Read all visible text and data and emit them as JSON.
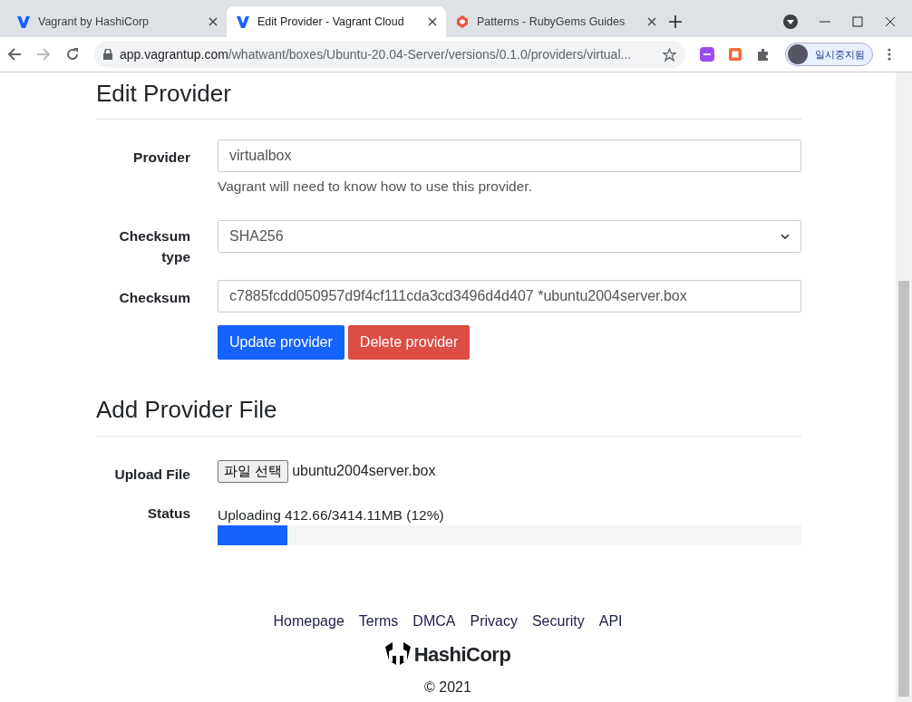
{
  "browser": {
    "tabs": [
      {
        "title": "Vagrant by HashiCorp",
        "selected": false,
        "kind": "vagrant"
      },
      {
        "title": "Edit Provider - Vagrant Cloud",
        "selected": true,
        "kind": "vagrant"
      },
      {
        "title": "Patterns - RubyGems Guides",
        "selected": false,
        "kind": "rubygems"
      }
    ],
    "url_host": "app.vagrantup.com",
    "url_path": "/whatwant/boxes/Ubuntu-20.04-Server/versions/0.1.0/providers/virtual...",
    "profile_label": "일시중지됨"
  },
  "edit_provider": {
    "heading": "Edit Provider",
    "provider": {
      "label": "Provider",
      "value": "virtualbox",
      "help": "Vagrant will need to know how to use this provider."
    },
    "checksum_type": {
      "label": "Checksum type",
      "value": "SHA256"
    },
    "checksum": {
      "label": "Checksum",
      "value": "c7885fcdd050957d9f4cf111cda3cd3496d4d407 *ubuntu2004server.box"
    },
    "buttons": [
      {
        "label": "Update provider",
        "kind": "primary"
      },
      {
        "label": "Delete provider",
        "kind": "danger"
      }
    ]
  },
  "add_provider_file": {
    "heading": "Add Provider File",
    "upload": {
      "label": "Upload File",
      "button": "파일 선택",
      "file_name": "ubuntu2004server.box"
    },
    "status": {
      "label": "Status",
      "text": "Uploading 412.66/3414.11MB (12%)",
      "level": 0.12
    }
  },
  "footer": {
    "links": [
      "Homepage",
      "Terms",
      "DMCA",
      "Privacy",
      "Security",
      "API"
    ],
    "logo_text": "HashiCorp",
    "copyright": "© 2021"
  }
}
